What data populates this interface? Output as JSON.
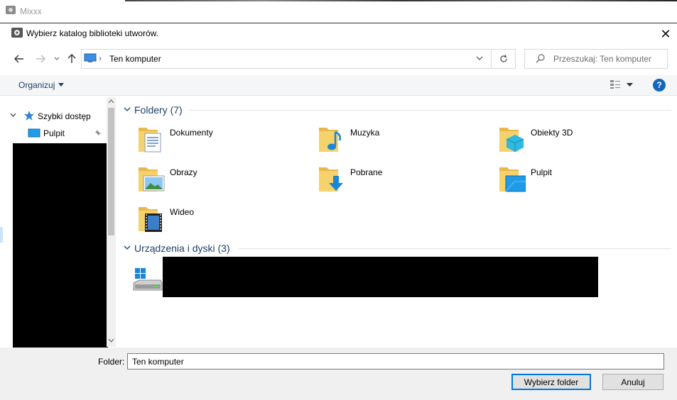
{
  "background_app": {
    "title": "Mixxx"
  },
  "dialog": {
    "title": "Wybierz katalog biblioteki utworów.",
    "close_glyph": "✕"
  },
  "nav": {
    "address": "Ten komputer",
    "search_placeholder": "Przeszukaj: Ten komputer"
  },
  "commandbar": {
    "organize_label": "Organizuj",
    "help_glyph": "?"
  },
  "navpane": {
    "quick_access": "Szybki dostęp",
    "items": [
      {
        "label": "Pulpit",
        "pinned": true
      }
    ]
  },
  "content": {
    "folders_header": "Foldery (7)",
    "folders": [
      {
        "label": "Dokumenty",
        "icon": "documents-folder-icon"
      },
      {
        "label": "Muzyka",
        "icon": "music-folder-icon"
      },
      {
        "label": "Obiekty 3D",
        "icon": "3d-objects-folder-icon"
      },
      {
        "label": "Obrazy",
        "icon": "pictures-folder-icon"
      },
      {
        "label": "Pobrane",
        "icon": "downloads-folder-icon"
      },
      {
        "label": "Pulpit",
        "icon": "desktop-folder-icon"
      },
      {
        "label": "Wideo",
        "icon": "videos-folder-icon"
      }
    ],
    "devices_header": "Urządzenia i dyski (3)"
  },
  "bottom": {
    "folder_label": "Folder:",
    "folder_value": "Ten komputer",
    "ok_label": "Wybierz folder",
    "cancel_label": "Anuluj"
  },
  "colors": {
    "accent": "#0078d7",
    "link_blue": "#1e3f6b",
    "folder_yellow": "#f5d26b"
  }
}
